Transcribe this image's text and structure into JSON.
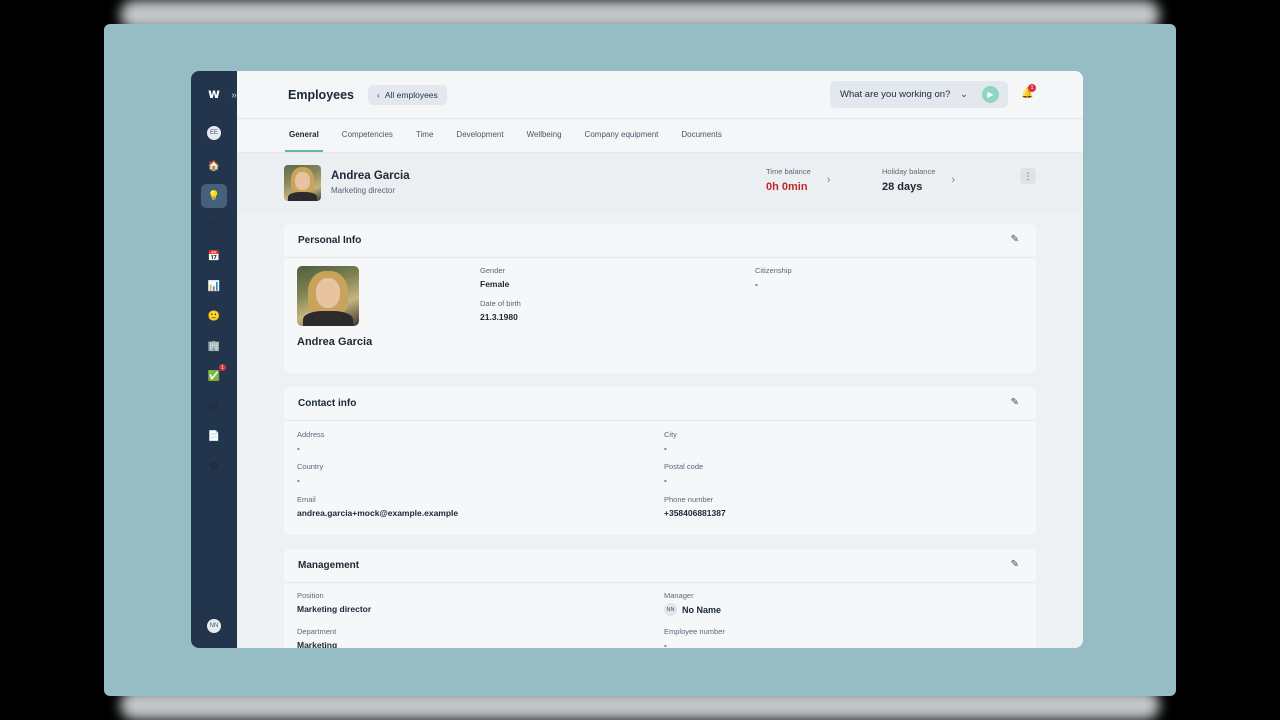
{
  "sidebar": {
    "logo": "w",
    "expand_icon": "»",
    "top_avatar": "EE",
    "bottom_avatar": "NN",
    "items": [
      {
        "name": "home",
        "icon": "🏠"
      },
      {
        "name": "employees",
        "icon": "💡"
      },
      {
        "name": "time",
        "icon": "⏱"
      },
      {
        "name": "calendar",
        "icon": "📅"
      },
      {
        "name": "reports",
        "icon": "📊"
      },
      {
        "name": "wellbeing",
        "icon": "🙂"
      },
      {
        "name": "organization",
        "icon": "🏢"
      },
      {
        "name": "tasks",
        "icon": "✅",
        "badge": "1"
      },
      {
        "name": "print",
        "icon": "🖨"
      },
      {
        "name": "documents",
        "icon": "📄"
      },
      {
        "name": "settings",
        "icon": "⚙"
      }
    ]
  },
  "header": {
    "title": "Employees",
    "back_label": "All employees",
    "working_placeholder": "What are you working on?",
    "notifications_count": "1"
  },
  "tabs": [
    {
      "label": "General",
      "active": true
    },
    {
      "label": "Competencies"
    },
    {
      "label": "Time"
    },
    {
      "label": "Development"
    },
    {
      "label": "Wellbeing"
    },
    {
      "label": "Company equipment"
    },
    {
      "label": "Documents"
    }
  ],
  "profile": {
    "name": "Andrea Garcia",
    "role": "Marketing director",
    "time_balance_label": "Time balance",
    "time_balance_value": "0h 0min",
    "holiday_balance_label": "Holiday balance",
    "holiday_balance_value": "28 days"
  },
  "personal_info": {
    "title": "Personal Info",
    "name": "Andrea Garcia",
    "gender_label": "Gender",
    "gender": "Female",
    "dob_label": "Date of birth",
    "dob": "21.3.1980",
    "citizenship_label": "Citizenship",
    "citizenship": "-"
  },
  "contact_info": {
    "title": "Contact info",
    "address_label": "Address",
    "address": "-",
    "city_label": "City",
    "city": "-",
    "country_label": "Country",
    "country": "-",
    "postal_label": "Postal code",
    "postal": "-",
    "email_label": "Email",
    "email": "andrea.garcia+mock@example.example",
    "phone_label": "Phone number",
    "phone": "+358406881387"
  },
  "management": {
    "title": "Management",
    "position_label": "Position",
    "position": "Marketing director",
    "manager_label": "Manager",
    "manager_initials": "NN",
    "manager": "No Name",
    "department_label": "Department",
    "department": "Marketing",
    "employee_number_label": "Employee number",
    "employee_number": "-"
  }
}
